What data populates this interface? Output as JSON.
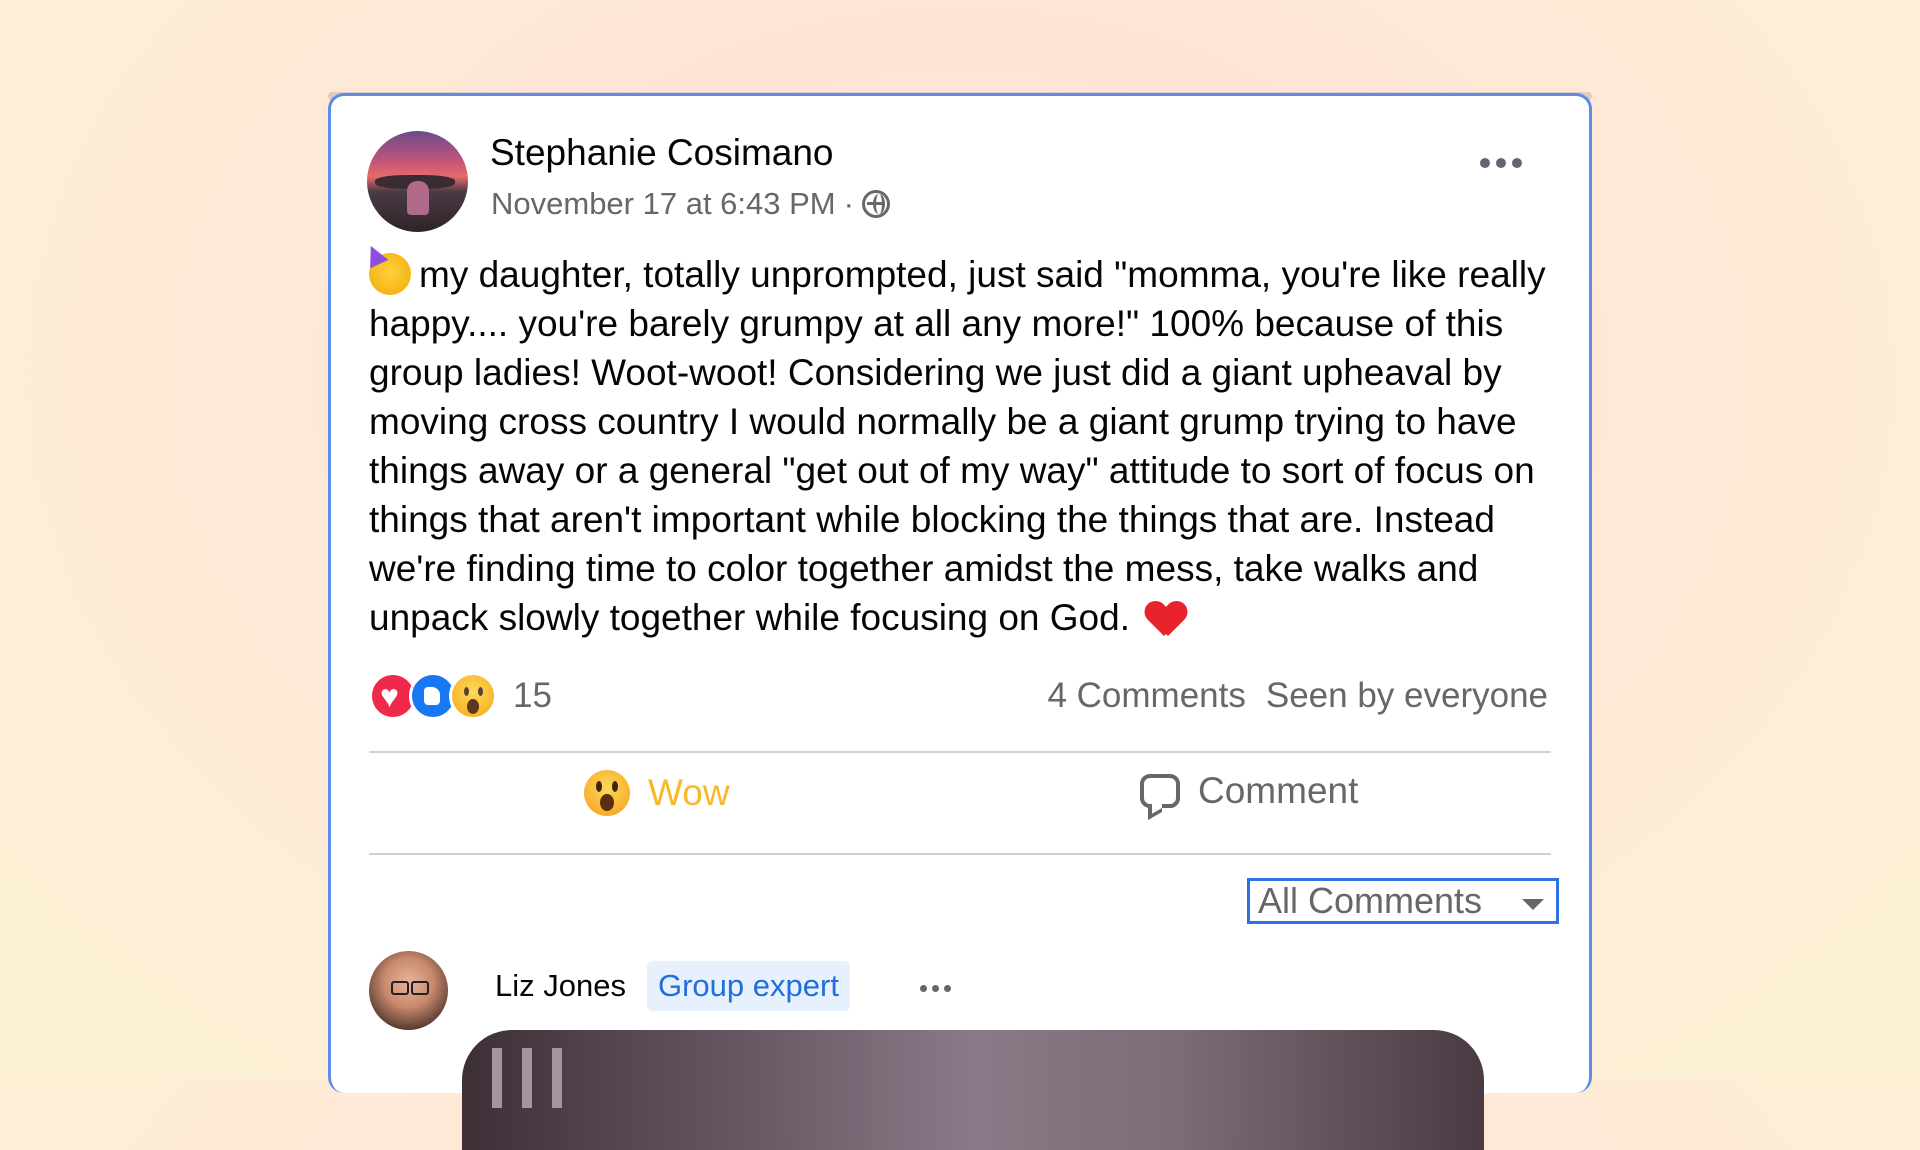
{
  "post": {
    "author": "Stephanie Cosimano",
    "timestamp": "November 17 at 6:43 PM",
    "separator": "·",
    "privacy_icon": "globe-icon",
    "text": "my daughter, totally unprompted, just said \"momma, you're like really happy.... you're barely grumpy at all any more!\" 100% because of this group ladies! Woot-woot! Considering we just did a giant upheaval by moving cross country I would normally be a giant grump trying to have things away or a general \"get out of my way\" attitude to sort of focus on things that aren't important while blocking the things that are. Instead we're finding time to color together amidst the mess, take walks and unpack slowly together while focusing on God.",
    "reaction_count": "15",
    "comments_count": "4 Comments",
    "seen_by": "Seen by everyone"
  },
  "actions": {
    "wow_label": "Wow",
    "comment_label": "Comment"
  },
  "comments_filter": {
    "label": "All Comments"
  },
  "comment": {
    "author": "Liz Jones",
    "badge": "Group expert"
  },
  "colors": {
    "accent": "#1877f2",
    "wow": "#f7b928",
    "focus_border": "#2d72e0"
  }
}
